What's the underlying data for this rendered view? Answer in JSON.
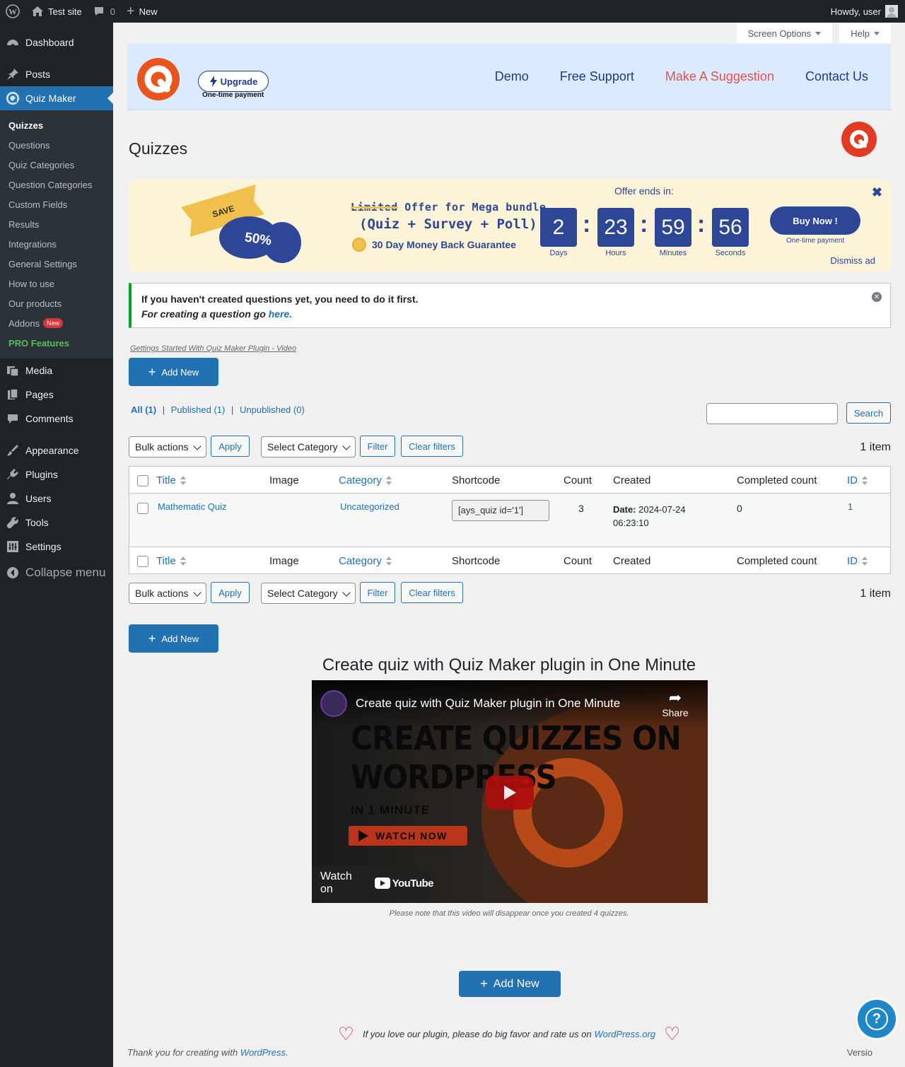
{
  "admin_bar": {
    "site_name": "Test site",
    "comments_count": "0",
    "new_label": "New",
    "howdy": "Howdy, user"
  },
  "sidebar": {
    "items_top": [
      {
        "label": "Dashboard",
        "icon": "dashboard-icon"
      },
      {
        "label": "Posts",
        "icon": "pin-icon"
      }
    ],
    "active": {
      "label": "Quiz Maker",
      "icon": "quiz-maker-icon"
    },
    "submenu": [
      "Quizzes",
      "Questions",
      "Quiz Categories",
      "Question Categories",
      "Custom Fields",
      "Results",
      "Integrations",
      "General Settings",
      "How to use",
      "Our products",
      "Addons"
    ],
    "addons_badge": "New",
    "pro": "PRO Features",
    "items_bottom": [
      {
        "label": "Media",
        "icon": "media-icon"
      },
      {
        "label": "Pages",
        "icon": "pages-icon"
      },
      {
        "label": "Comments",
        "icon": "comment-icon"
      },
      {
        "label": "Appearance",
        "icon": "paintbrush-icon"
      },
      {
        "label": "Plugins",
        "icon": "plugin-icon"
      },
      {
        "label": "Users",
        "icon": "user-icon"
      },
      {
        "label": "Tools",
        "icon": "wrench-icon"
      },
      {
        "label": "Settings",
        "icon": "settings-icon"
      }
    ],
    "collapse": "Collapse menu"
  },
  "screen_tabs": {
    "options": "Screen Options",
    "help": "Help"
  },
  "plugin_header": {
    "upgrade": "Upgrade",
    "one_time": "One-time payment",
    "nav": [
      "Demo",
      "Free Support",
      "Make A Suggestion",
      "Contact Us"
    ]
  },
  "page_title": "Quizzes",
  "promo": {
    "save": "SAVE",
    "percent": "50%",
    "offer_strike": "Limited",
    "offer_rest": " Offer for Mega bundle",
    "bundle": "(Quiz + Survey + Poll)",
    "guarantee": "30 Day Money Back Guarantee",
    "ends_label": "Offer ends in:",
    "countdown": [
      {
        "value": "2",
        "label": "Days"
      },
      {
        "value": "23",
        "label": "Hours"
      },
      {
        "value": "59",
        "label": "Minutes"
      },
      {
        "value": "56",
        "label": "Seconds"
      }
    ],
    "buy": "Buy Now !",
    "buy_note": "One-time payment",
    "dismiss": "Dismiss ad"
  },
  "notice": {
    "line1": "If you haven't created questions yet, you need to do it first.",
    "line2": "For creating a question go ",
    "link": "here."
  },
  "video_link": "Gettings Started With Quiz Maker Plugin - Video",
  "add_new": "Add New",
  "views": {
    "all": "All (1)",
    "published": "Published (1)",
    "unpublished": "Unpublished (0)",
    "sep": "|"
  },
  "search_btn": "Search",
  "tablenav": {
    "bulk": "Bulk actions",
    "apply": "Apply",
    "category": "Select Category",
    "filter": "Filter",
    "clear": "Clear filters",
    "count": "1 item"
  },
  "table": {
    "columns": [
      "Title",
      "Image",
      "Category",
      "Shortcode",
      "Count",
      "Created",
      "Completed count",
      "ID"
    ],
    "rows": [
      {
        "title": "Mathematic Quiz",
        "category": "Uncategorized",
        "shortcode": "[ays_quiz id='1']",
        "count": "3",
        "created_label": "Date:",
        "created_date": "2024-07-24",
        "created_time": "06:23:10",
        "completed": "0",
        "id": "1"
      }
    ]
  },
  "video": {
    "heading": "Create quiz with Quiz Maker plugin in One Minute",
    "yt_title": "Create quiz with Quiz Maker plugin in One Minute",
    "share": "Share",
    "big1": "CREATE QUIZZES ON",
    "big2": "WORDPRESS",
    "small": "IN 1 MINUTE",
    "watch_now": "WATCH NOW",
    "watch_on": "Watch on",
    "yt_brand": "YouTube",
    "note": "Please note that this video will disappear once you created 4 quizzes."
  },
  "rate": {
    "text": "If you love our plugin, please do big favor and rate us on ",
    "link": "WordPress.org"
  },
  "footer": {
    "thanks": "Thank you for creating with ",
    "wp": "WordPress",
    "dot": ".",
    "version": "Versio"
  },
  "colors": {
    "accent": "#2271b1",
    "brand_orange": "#e8541c",
    "promo_blue": "#2d4696",
    "promo_bg": "#fdf3d7"
  }
}
